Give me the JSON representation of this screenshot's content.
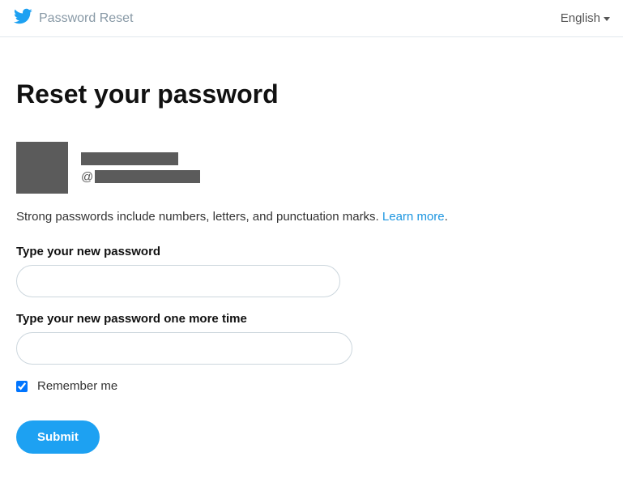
{
  "topbar": {
    "title": "Password Reset",
    "language": "English"
  },
  "page": {
    "heading": "Reset your password"
  },
  "user": {
    "at_symbol": "@"
  },
  "hint": {
    "text": "Strong passwords include numbers, letters, and punctuation marks. ",
    "link": "Learn more",
    "period": "."
  },
  "form": {
    "password_label": "Type your new password",
    "password_confirm_label": "Type your new password one more time",
    "remember_label": "Remember me",
    "remember_checked": true,
    "submit_label": "Submit"
  }
}
